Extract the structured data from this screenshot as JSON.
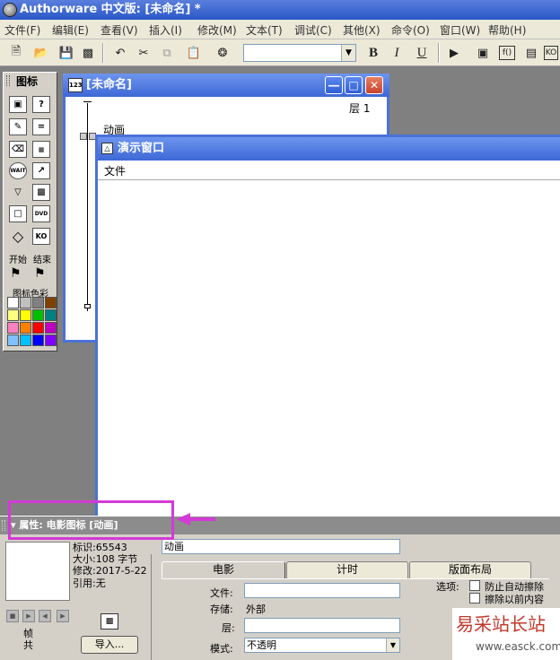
{
  "window": {
    "title": "Authorware 中文版: [未命名] *"
  },
  "menu": [
    "文件(F)",
    "编辑(E)",
    "查看(V)",
    "插入(I)",
    "修改(M)",
    "文本(T)",
    "调试(C)",
    "其他(X)",
    "命令(O)",
    "窗口(W)",
    "帮助(H)"
  ],
  "toolbar": {
    "bold": "B",
    "italic": "I",
    "underline": "U",
    "font_value": ""
  },
  "palette": {
    "title": "图标",
    "start_label": "开始",
    "end_label": "结束",
    "color_label": "图标色彩",
    "icons": [
      "display",
      "interaction",
      "calculation",
      "map",
      "erase",
      "framework",
      "wait",
      "navigate",
      "decision",
      "digital-movie",
      "sound",
      "video",
      "DVD",
      "knowledge-object"
    ],
    "colors": [
      "#ffffff",
      "#c0c0c0",
      "#808080",
      "#804000",
      "#ffff80",
      "#ffff00",
      "#00c000",
      "#008080",
      "#ff80c0",
      "#ff8000",
      "#ff0000",
      "#c000c0",
      "#80c0ff",
      "#00c0ff",
      "#0000ff",
      "#8000ff"
    ]
  },
  "flowline": {
    "title": "[未命名]",
    "layer": "层 1",
    "icon_label": "动画"
  },
  "presentation": {
    "title": "演示窗口",
    "menu_file": "文件"
  },
  "properties": {
    "header": "属性: 电影图标 [动画]",
    "id_label": "标识:65543",
    "size_label": "大小:108 字节",
    "modified_label": "修改:2017-5-22",
    "ref_label": "引用:无",
    "name_value": "动画",
    "frame_label": "帧",
    "total_label": "共",
    "import_button": "导入...",
    "tabs": [
      "电影",
      "计时",
      "版面布局"
    ],
    "file_label": "文件:",
    "file_value": "",
    "storage_label": "存储:",
    "storage_value": "外部",
    "layer_label": "层:",
    "layer_value": "",
    "mode_label": "模式:",
    "mode_value": "不透明",
    "options_label": "选项:",
    "options": [
      "防止自动擦除",
      "擦除以前内容"
    ]
  },
  "watermark": {
    "cn": "易采站长站",
    "url": "www.easck.com"
  },
  "colors": {
    "accent": "#3d68d6",
    "highlight": "#d33ad6"
  }
}
